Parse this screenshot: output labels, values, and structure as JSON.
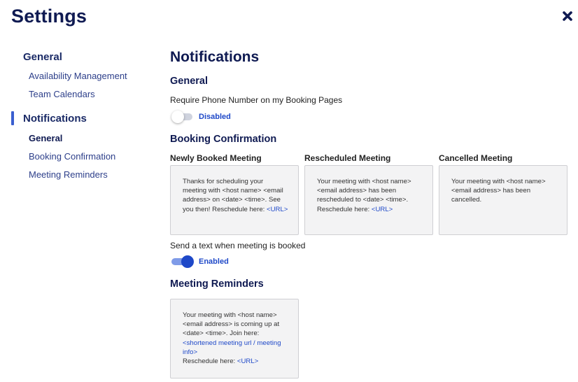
{
  "header": {
    "title": "Settings",
    "close_icon": "close-x-icon"
  },
  "sidebar": {
    "general_heading": "General",
    "general_items": [
      {
        "label": "Availability Management"
      },
      {
        "label": "Team Calendars"
      }
    ],
    "notifications_heading": "Notifications",
    "notifications_items": [
      {
        "label": "General",
        "active": true
      },
      {
        "label": "Booking Confirmation",
        "active": false
      },
      {
        "label": "Meeting Reminders",
        "active": false
      }
    ]
  },
  "main": {
    "title": "Notifications",
    "general": {
      "title": "General",
      "phone_label": "Require Phone Number on my Booking Pages",
      "phone_toggle": {
        "state": "off",
        "label": "Disabled"
      }
    },
    "booking_confirmation": {
      "title": "Booking Confirmation",
      "columns": [
        {
          "heading": "Newly Booked Meeting",
          "message_text": "Thanks for scheduling your meeting with <host name> <email address> on <date> <time>. See you then! Reschedule here:",
          "message_link": "<URL>"
        },
        {
          "heading": "Rescheduled Meeting",
          "message_text": "Your meeting with <host name> <email address> has been rescheduled to <date> <time>. Reschedule here:",
          "message_link": "<URL>"
        },
        {
          "heading": "Cancelled Meeting",
          "message_text": "Your meeting with <host name> <email address> has been cancelled.",
          "message_link": ""
        }
      ],
      "text_label": "Send a text when meeting is booked",
      "text_toggle": {
        "state": "on",
        "label": "Enabled"
      }
    },
    "meeting_reminders": {
      "title": "Meeting Reminders",
      "message_text": "Your meeting with <host name> <email address> is coming up at <date> <time>. Join here:",
      "message_link": "<shortened meeting url / meeting info>",
      "reschedule_text": "Reschedule here:",
      "reschedule_link": "<URL>"
    }
  },
  "colors": {
    "navy": "#0f1a52",
    "accent_blue": "#1e48c8",
    "box_bg": "#f3f3f4",
    "active_bar": "#3a5fd0"
  }
}
